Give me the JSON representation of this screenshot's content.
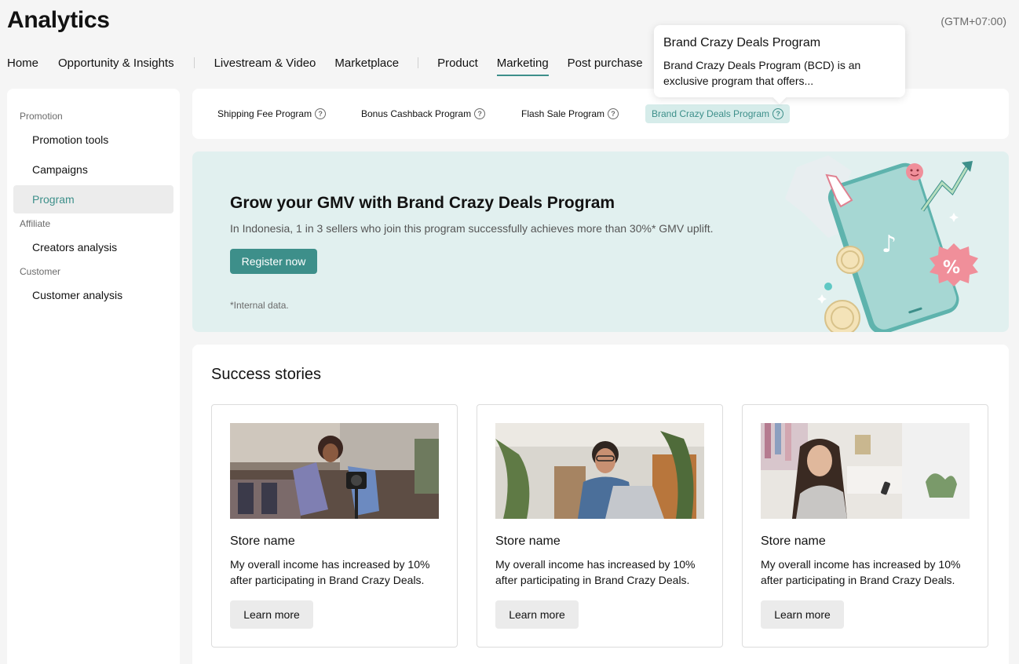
{
  "app": {
    "title": "Analytics",
    "timezone": "(GTM+07:00)"
  },
  "topnav": {
    "items": [
      {
        "label": "Home"
      },
      {
        "label": "Opportunity & Insights"
      },
      {
        "label": "Livestream & Video"
      },
      {
        "label": "Marketplace"
      },
      {
        "label": "Product"
      },
      {
        "label": "Marketing",
        "active": true
      },
      {
        "label": "Post purchase"
      }
    ]
  },
  "sidebar": {
    "sections": [
      {
        "title": "Promotion",
        "items": [
          {
            "label": "Promotion tools"
          },
          {
            "label": "Campaigns"
          },
          {
            "label": "Program",
            "active": true
          }
        ]
      },
      {
        "title": "Affiliate",
        "items": [
          {
            "label": "Creators analysis"
          }
        ]
      },
      {
        "title": "Customer",
        "items": [
          {
            "label": "Customer analysis"
          }
        ]
      }
    ]
  },
  "tabs": {
    "items": [
      {
        "label": "Shipping Fee Program",
        "icon": "question-icon"
      },
      {
        "label": "Bonus Cashback Program",
        "icon": "question-icon"
      },
      {
        "label": "Flash Sale Program",
        "icon": "question-icon"
      },
      {
        "label": "Brand Crazy Deals Program",
        "icon": "question-icon",
        "active": true
      }
    ]
  },
  "tooltip": {
    "title": "Brand Crazy Deals Program",
    "body": "Brand Crazy Deals Program (BCD) is an exclusive program that offers..."
  },
  "banner": {
    "title": "Grow your GMV with Brand Crazy Deals Program",
    "subtitle": "In Indonesia, 1 in 3 sellers who join this program successfully achieves more than 30%* GMV uplift.",
    "cta": "Register now",
    "note": "*Internal data.",
    "badge_text": "%"
  },
  "stories": {
    "title": "Success stories",
    "cards": [
      {
        "name": "Store name",
        "text": "My overall income has increased by 10% after participating in Brand Crazy Deals.",
        "cta": "Learn more"
      },
      {
        "name": "Store name",
        "text": "My overall income has increased by 10% after participating in Brand Crazy Deals.",
        "cta": "Learn more"
      },
      {
        "name": "Store name",
        "text": "My overall income has increased by 10% after participating in Brand Crazy Deals.",
        "cta": "Learn more"
      }
    ]
  },
  "colors": {
    "accent": "#3d8f8a",
    "banner_bg": "#e1f0ef",
    "active_tab_bg": "#d6ecea"
  }
}
